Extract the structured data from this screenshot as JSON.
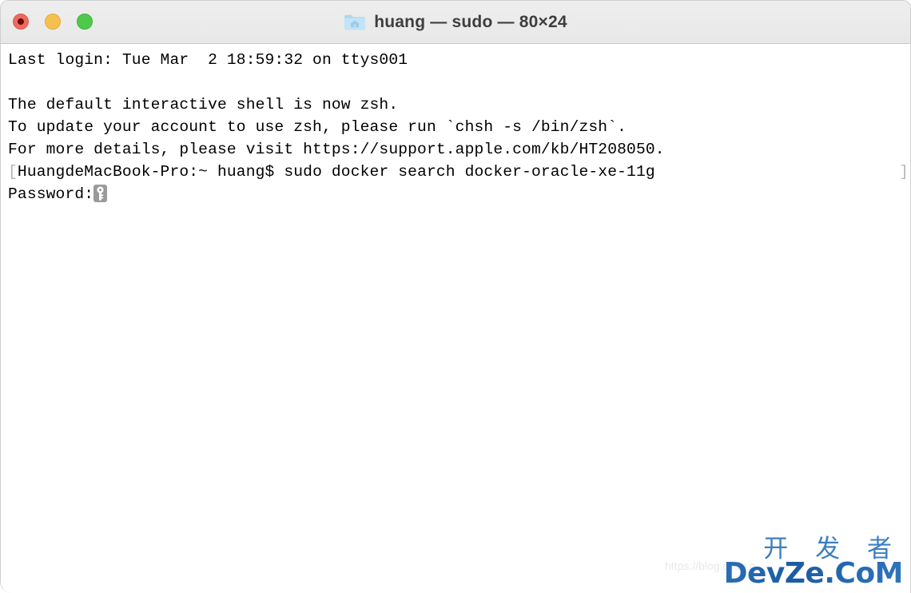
{
  "window": {
    "title": "huang — sudo — 80×24",
    "folder_icon": "home-folder-icon",
    "controls": {
      "close_label": "",
      "minimize_label": "",
      "maximize_label": ""
    }
  },
  "terminal": {
    "lines": [
      {
        "id": "login",
        "text": "Last login: Tue Mar  2 18:59:32 on ttys001"
      },
      {
        "id": "blank1",
        "text": " "
      },
      {
        "id": "shell_notice_1",
        "text": "The default interactive shell is now zsh."
      },
      {
        "id": "shell_notice_2",
        "text": "To update your account to use zsh, please run `chsh -s /bin/zsh`."
      },
      {
        "id": "shell_notice_3",
        "text": "For more details, please visit https://support.apple.com/kb/HT208050."
      }
    ],
    "prompt_line": {
      "left_bracket": "[",
      "prompt": "HuangdeMacBook-Pro:~ huang$ ",
      "command": "sudo docker search docker-oracle-xe-11g",
      "right_bracket": "]"
    },
    "password_line": {
      "label": "Password:",
      "cursor_icon": "key-icon"
    },
    "colors": {
      "background": "#ffffff",
      "foreground": "#000000",
      "bracket": "#b4b4b4",
      "cursor": "#9a9a9a"
    }
  },
  "watermark": {
    "faint_url": "https://blog.csdn.n",
    "chinese": "开 发 者",
    "brand": "DevZe.CoM",
    "brand_color": "#1f5fa8"
  }
}
